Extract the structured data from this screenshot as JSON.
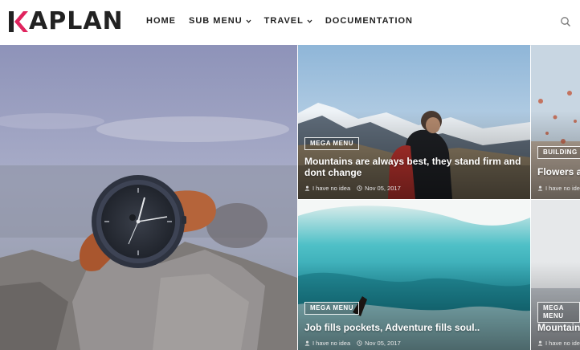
{
  "brand": {
    "logo_text": "APLAN",
    "logo_letter": "K"
  },
  "nav": {
    "items": [
      {
        "label": "HOME",
        "has_dropdown": false
      },
      {
        "label": "SUB MENU",
        "has_dropdown": true
      },
      {
        "label": "TRAVEL",
        "has_dropdown": true
      },
      {
        "label": "DOCUMENTATION",
        "has_dropdown": false
      }
    ],
    "search_icon": "search-icon"
  },
  "posts": [
    {
      "category": "MEGA MENU",
      "title": "Mountains are always best, they stand firm and dont change",
      "author": "I have no idea",
      "date": "Nov 05, 2017"
    },
    {
      "category": "BUILDING",
      "title": "Flowers a",
      "author": "I have no idea",
      "date": ""
    },
    {
      "category": "MEGA MENU",
      "title": "Job fills pockets, Adventure fills soul..",
      "author": "I have no idea",
      "date": "Nov 05, 2017"
    },
    {
      "category": "MEGA MENU",
      "title": "Mountain",
      "author": "I have no idea",
      "date": ""
    }
  ],
  "colors": {
    "accent": "#e0245e",
    "nav_text": "#222222"
  }
}
